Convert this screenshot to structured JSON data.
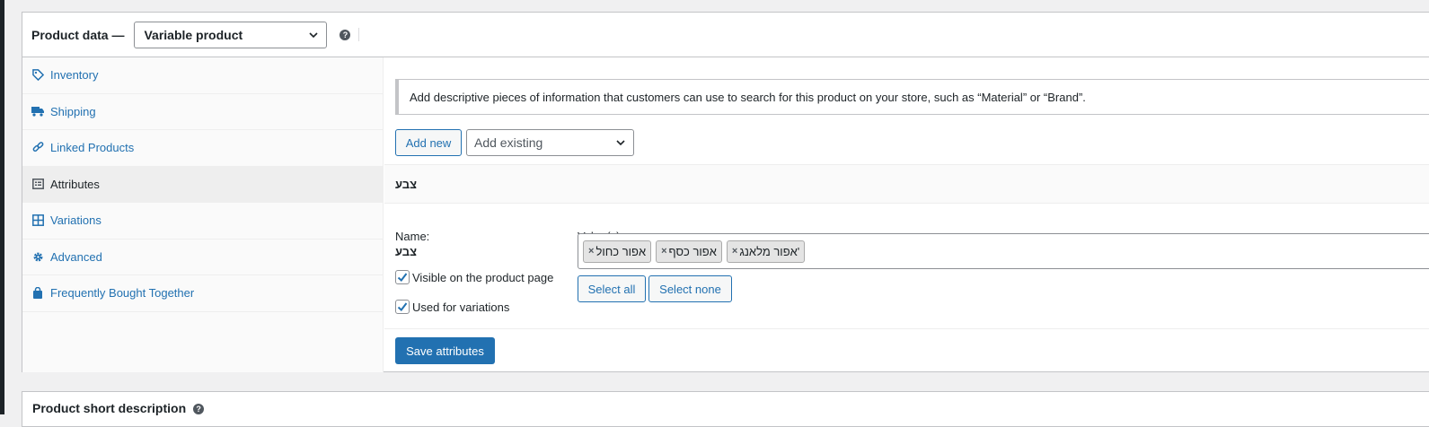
{
  "product_data": {
    "title": "Product data —",
    "type_value": "Variable product",
    "help_icon_glyph": "?"
  },
  "tabs": [
    {
      "label": "Inventory",
      "icon": "tag-icon"
    },
    {
      "label": "Shipping",
      "icon": "truck-icon"
    },
    {
      "label": "Linked Products",
      "icon": "link-icon"
    },
    {
      "label": "Attributes",
      "icon": "list-icon",
      "active": true
    },
    {
      "label": "Variations",
      "icon": "grid-icon"
    },
    {
      "label": "Advanced",
      "icon": "gear-icon"
    },
    {
      "label": "Frequently Bought Together",
      "icon": "bag-icon"
    }
  ],
  "attributes_panel": {
    "notice": "Add descriptive pieces of information that customers can use to search for this product on your store, such as “Material” or “Brand”.",
    "add_new_label": "Add new",
    "add_existing_placeholder": "Add existing",
    "attribute": {
      "heading": "צבע",
      "name_label": "Name:",
      "name_value": "צבע",
      "values_label": "Value(s):",
      "values": [
        "אפור כחול",
        "אפור כסף",
        "אפור מלאנג'"
      ],
      "chip_remove_glyph": "×",
      "visible_label": "Visible on the product page",
      "visible_checked": true,
      "variations_label": "Used for variations",
      "variations_checked": true,
      "select_all_label": "Select all",
      "select_none_label": "Select none"
    },
    "save_label": "Save attributes"
  },
  "short_description": {
    "title": "Product short description",
    "help_icon_glyph": "?"
  },
  "colors": {
    "accent": "#2271b1",
    "border": "#c3c4c7"
  }
}
